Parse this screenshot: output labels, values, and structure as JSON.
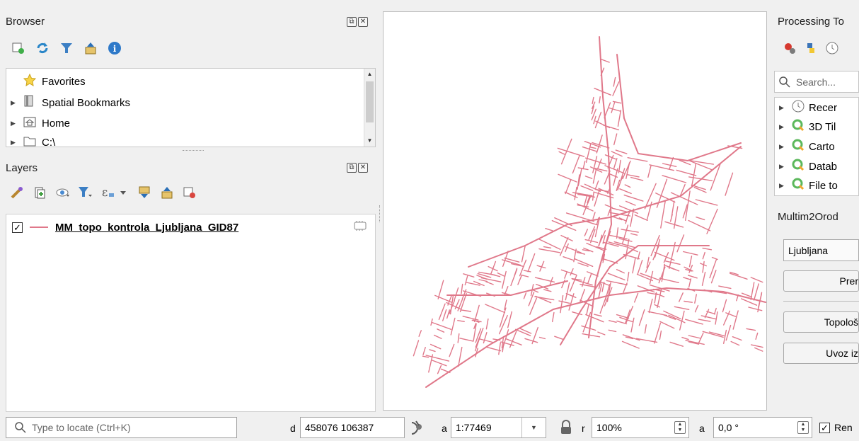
{
  "browser": {
    "title": "Browser",
    "items": [
      {
        "label": "Favorites",
        "icon": "star-icon",
        "expandable": false
      },
      {
        "label": "Spatial Bookmarks",
        "icon": "bookmark-icon",
        "expandable": true
      },
      {
        "label": "Home",
        "icon": "home-folder-icon",
        "expandable": true
      },
      {
        "label": "C:\\",
        "icon": "folder-icon",
        "expandable": true
      }
    ]
  },
  "layers": {
    "title": "Layers",
    "items": [
      {
        "label": "MM_topo_kontrola_Ljubljana_GID87",
        "checked": true,
        "line_color": "#e0788a"
      }
    ]
  },
  "processing": {
    "title": "Processing To",
    "search_placeholder": "Search...",
    "items": [
      {
        "label": "Recer",
        "icon": "clock-icon"
      },
      {
        "label": "3D Til",
        "icon": "qgis-icon"
      },
      {
        "label": "Carto",
        "icon": "qgis-icon"
      },
      {
        "label": "Datab",
        "icon": "qgis-icon"
      },
      {
        "label": "File to",
        "icon": "qgis-icon"
      }
    ]
  },
  "plugin": {
    "title": "Multim2Orod",
    "combo_value": "Ljubljana",
    "buttons": [
      "Prer",
      "Topološ",
      "Uvoz iz"
    ]
  },
  "statusbar": {
    "locate_placeholder": "Type to locate (Ctrl+K)",
    "coord_label": "d",
    "coordinate": "458076 106387",
    "scale_label": "a",
    "scale": "1:77469",
    "magnifier_label": "r",
    "magnifier": "100%",
    "rotation_label": "a",
    "rotation": "0,0 °",
    "render_label": "Ren",
    "render_checked": true
  },
  "colors": {
    "road_line": "#e0788a",
    "qgis_green": "#5cb85c",
    "map_background": "#ffffff"
  }
}
